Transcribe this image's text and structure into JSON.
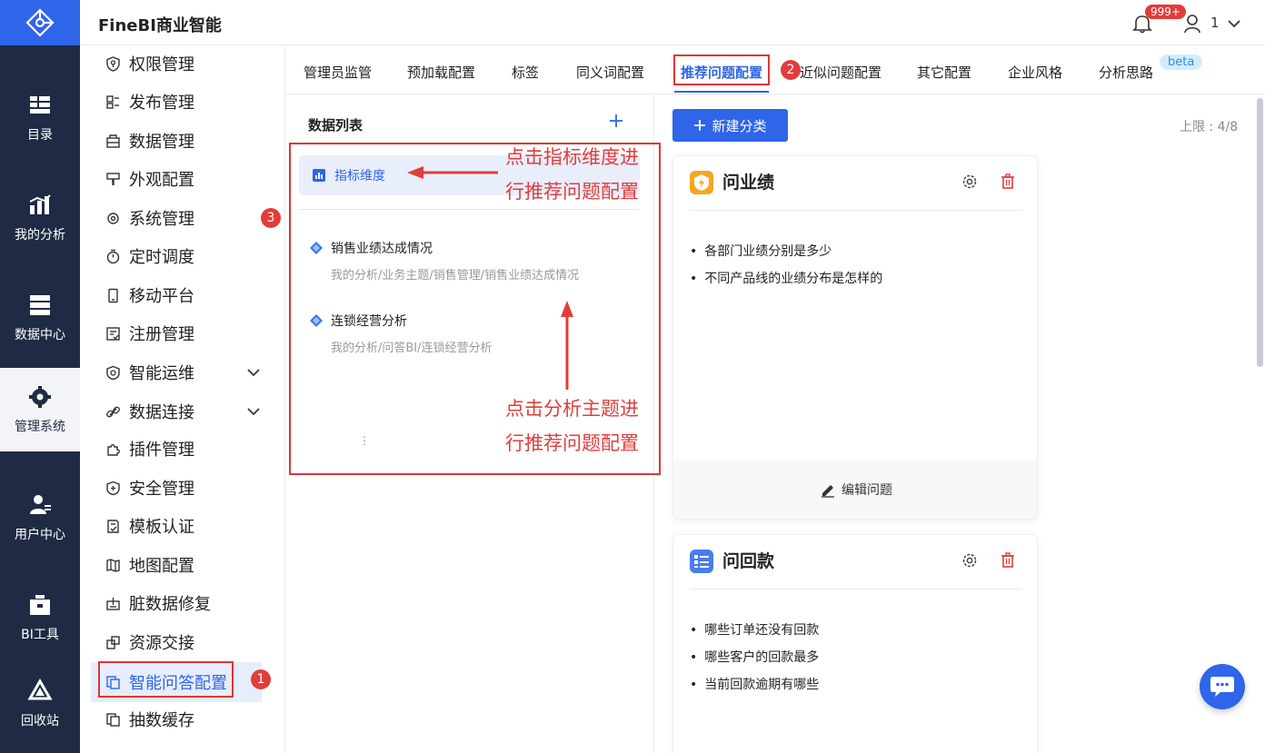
{
  "app": {
    "title": "FineBI商业智能"
  },
  "header": {
    "notification_count": "999+",
    "user_name": "1"
  },
  "rail": [
    {
      "label": "目录",
      "icon": "catalog-icon"
    },
    {
      "label": "我的分析",
      "icon": "analysis-icon"
    },
    {
      "label": "数据中心",
      "icon": "data-center-icon"
    },
    {
      "label": "管理系统",
      "icon": "gear-icon",
      "active": true
    },
    {
      "label": "用户中心",
      "icon": "user-center-icon"
    },
    {
      "label": "BI工具",
      "icon": "toolbox-icon"
    },
    {
      "label": "回收站",
      "icon": "recycle-icon"
    }
  ],
  "menu": [
    {
      "label": "权限管理",
      "icon": "shield-key-icon"
    },
    {
      "label": "发布管理",
      "icon": "publish-icon"
    },
    {
      "label": "数据管理",
      "icon": "database-icon"
    },
    {
      "label": "外观配置",
      "icon": "brush-icon"
    },
    {
      "label": "系统管理",
      "icon": "settings-icon"
    },
    {
      "label": "定时调度",
      "icon": "timer-icon"
    },
    {
      "label": "移动平台",
      "icon": "mobile-icon"
    },
    {
      "label": "注册管理",
      "icon": "register-icon"
    },
    {
      "label": "智能运维",
      "icon": "ops-icon",
      "expandable": true
    },
    {
      "label": "数据连接",
      "icon": "link-icon",
      "expandable": true
    },
    {
      "label": "插件管理",
      "icon": "plugin-icon"
    },
    {
      "label": "安全管理",
      "icon": "security-icon"
    },
    {
      "label": "模板认证",
      "icon": "template-cert-icon"
    },
    {
      "label": "地图配置",
      "icon": "map-icon"
    },
    {
      "label": "脏数据修复",
      "icon": "repair-icon"
    },
    {
      "label": "资源交接",
      "icon": "handover-icon"
    },
    {
      "label": "智能问答配置",
      "icon": "qa-config-icon",
      "active": true
    },
    {
      "label": "抽数缓存",
      "icon": "cache-icon"
    }
  ],
  "markers": [
    "1",
    "2",
    "3"
  ],
  "tabs": [
    {
      "label": "管理员监管"
    },
    {
      "label": "预加载配置"
    },
    {
      "label": "标签"
    },
    {
      "label": "同义词配置"
    },
    {
      "label": "推荐问题配置",
      "active": true
    },
    {
      "label": "近似问题配置"
    },
    {
      "label": "其它配置"
    },
    {
      "label": "企业风格"
    },
    {
      "label": "分析思路"
    }
  ],
  "beta_label": "beta",
  "data_list": {
    "title": "数据列表",
    "dimension_item": "指标维度",
    "subjects": [
      {
        "name": "销售业绩达成情况",
        "path": "我的分析/业务主题/销售管理/销售业绩达成情况"
      },
      {
        "name": "连锁经营分析",
        "path": "我的分析/问答BI/连锁经营分析"
      }
    ]
  },
  "annotations": {
    "top_line1": "点击指标维度进",
    "top_line2": "行推荐问题配置",
    "bottom_line1": "点击分析主题进",
    "bottom_line2": "行推荐问题配置"
  },
  "config": {
    "new_category": "新建分类",
    "limit": "上限 : 4/8",
    "edit_label": "编辑问题",
    "cards": [
      {
        "title": "问业绩",
        "icon": "lightning-icon",
        "icon_color": "#f5a623",
        "questions": [
          "各部门业绩分别是多少",
          "不同产品线的业绩分布是怎样的"
        ]
      },
      {
        "title": "问回款",
        "icon": "list-icon",
        "icon_color": "#4a7cf0",
        "questions": [
          "哪些订单还没有回款",
          "哪些客户的回款最多",
          "当前回款逾期有哪些"
        ]
      }
    ]
  },
  "colors": {
    "primary": "#2f65e8",
    "rail_bg": "#1f2b44",
    "annotation_red": "#e23c3c"
  }
}
